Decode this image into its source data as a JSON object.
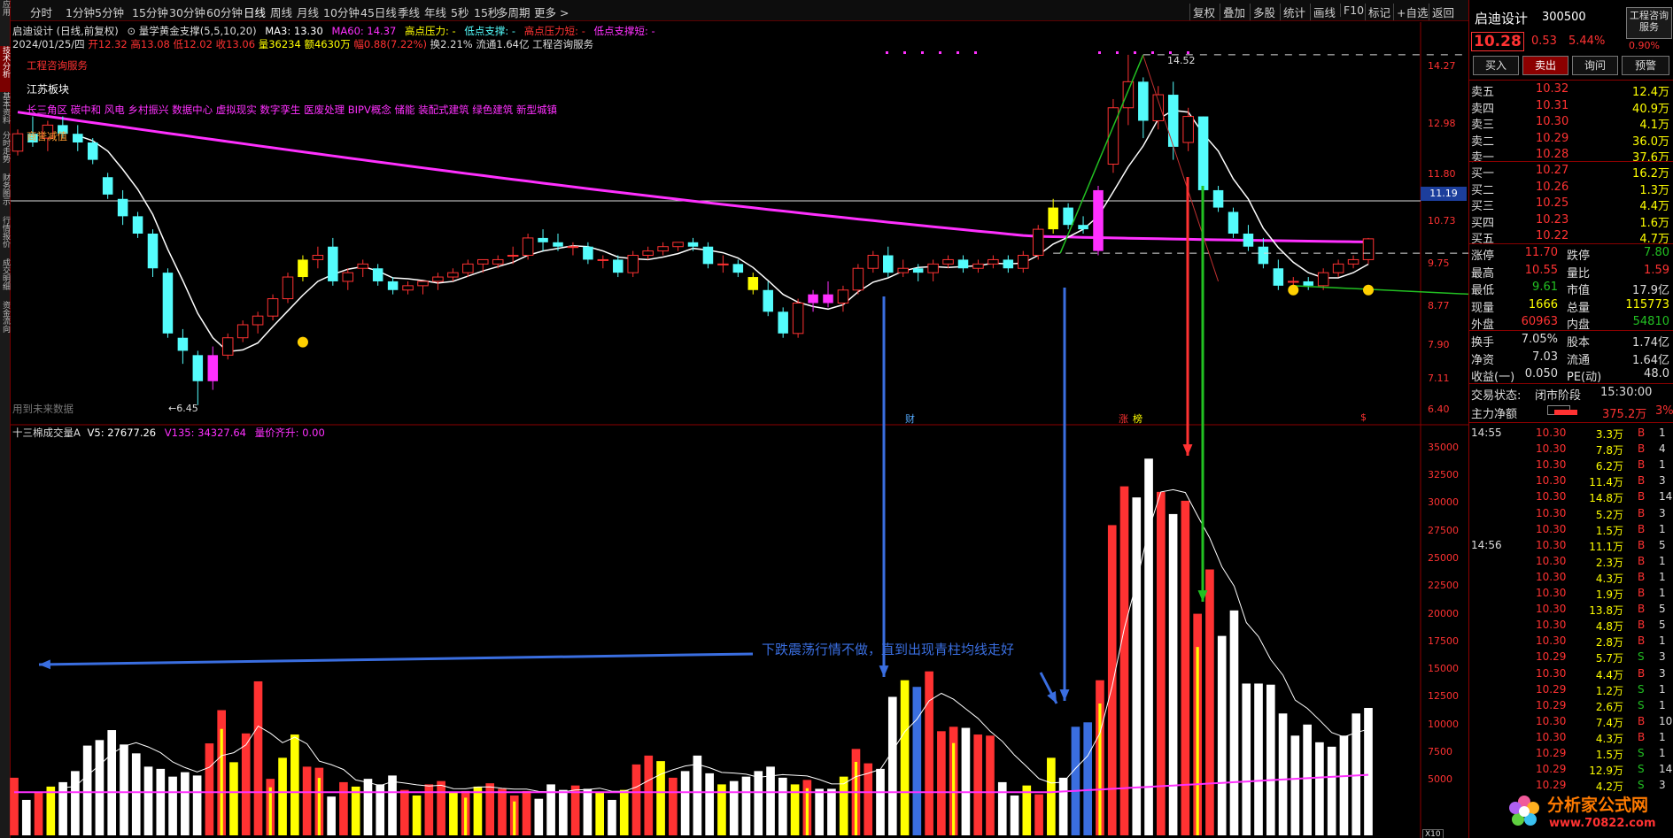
{
  "toolbar": {
    "periods": [
      "分时",
      "1分钟",
      "5分钟",
      "15分钟",
      "30分钟",
      "60分钟",
      "日线",
      "周线",
      "月线",
      "10分钟",
      "45日线",
      "季线",
      "年线",
      "5秒",
      "15秒",
      "多周期",
      "更多 >"
    ],
    "actions": [
      "复权",
      "叠加",
      "多股",
      "统计",
      "画线",
      "F10",
      "标记",
      "+自选",
      "返回"
    ]
  },
  "side_tabs": [
    "应用",
    "技术分析",
    "基本资料",
    "分时走势",
    "财务图示",
    "行情报价",
    "成交明细",
    "资金流向"
  ],
  "chart_header": {
    "line1": [
      "启迪设计 (日线,前复权)",
      "⊙ 量学黄金支撑(5,5,10,20)",
      "MA3: 13.30",
      "MA60: 14.37",
      "高点压力: -",
      "低点支撑: -",
      "高点压力短: -",
      "低点支撑短: -"
    ],
    "line2": [
      "2024/01/25/四",
      "开12.32",
      "高13.08",
      "低12.02",
      "收13.06",
      "量36234",
      "额4630万",
      "幅0.88(7.22%)",
      "换2.21%",
      "流通1.64亿",
      "工程咨询服务"
    ]
  },
  "overlay": {
    "industry": "工程咨询服务",
    "region": "江苏板块",
    "concepts": "长三角区 碳中和 风电 乡村振兴 数据中心 虚拟现实 数字孪生 医废处理 BIPV概念 储能 装配式建筑 绿色建筑 新型城镇",
    "merger": "商誉减值",
    "future_note": "用到未来数据",
    "high_label": "14.52",
    "low_label": "←6.45",
    "marker_cai": "财",
    "marker_zt": "涨",
    "marker_bang": "榜",
    "marker_s": "$"
  },
  "annotation": "下跌震荡行情不做，直到出现青柱均线走好",
  "price_axis": [
    "14.27",
    "12.98",
    "11.80",
    "10.73",
    "9.75",
    "8.77",
    "7.90",
    "7.11",
    "6.40"
  ],
  "current_price_tag": "11.19",
  "volume_header": [
    "十三棉成交量A",
    "V5: 27677.26",
    "V135: 34327.64",
    "量价齐升: 0.00"
  ],
  "volume_axis": [
    "35000",
    "32500",
    "30000",
    "27500",
    "25000",
    "22500",
    "20000",
    "17500",
    "15000",
    "12500",
    "10000",
    "7500",
    "5000"
  ],
  "volume_axis_unit": "X10",
  "stock": {
    "name": "启迪设计",
    "code": "300500",
    "price": "10.28",
    "change": "0.53",
    "pct": "5.44%",
    "badge_line1": "工程咨询",
    "badge_line2": "服务",
    "badge_pct": "0.90%"
  },
  "trade_buttons": [
    "买入",
    "卖出",
    "询问",
    "预警"
  ],
  "order_book": {
    "asks": [
      {
        "label": "卖五",
        "price": "10.32",
        "vol": "12.4万"
      },
      {
        "label": "卖四",
        "price": "10.31",
        "vol": "40.9万"
      },
      {
        "label": "卖三",
        "price": "10.30",
        "vol": "4.1万"
      },
      {
        "label": "卖二",
        "price": "10.29",
        "vol": "36.0万"
      },
      {
        "label": "卖一",
        "price": "10.28",
        "vol": "37.6万"
      }
    ],
    "bids": [
      {
        "label": "买一",
        "price": "10.27",
        "vol": "16.2万"
      },
      {
        "label": "买二",
        "price": "10.26",
        "vol": "1.3万"
      },
      {
        "label": "买三",
        "price": "10.25",
        "vol": "4.4万"
      },
      {
        "label": "买四",
        "price": "10.23",
        "vol": "1.6万"
      },
      {
        "label": "买五",
        "price": "10.22",
        "vol": "4.7万"
      }
    ]
  },
  "quote": [
    {
      "k1": "涨停",
      "v1": "11.70",
      "k2": "跌停",
      "v2": "7.80"
    },
    {
      "k1": "最高",
      "v1": "10.55",
      "k2": "量比",
      "v2": "1.59"
    },
    {
      "k1": "最低",
      "v1": "9.61",
      "k2": "市值",
      "v2": "17.9亿"
    },
    {
      "k1": "现量",
      "v1": "1666",
      "k2": "总量",
      "v2": "115773"
    },
    {
      "k1": "外盘",
      "v1": "60963",
      "k2": "内盘",
      "v2": "54810"
    }
  ],
  "fundamentals": [
    {
      "k1": "换手",
      "v1": "7.05%",
      "k2": "股本",
      "v2": "1.74亿"
    },
    {
      "k1": "净资",
      "v1": "7.03",
      "k2": "流通",
      "v2": "1.64亿"
    },
    {
      "k1": "收益(一)",
      "v1": "0.050",
      "k2": "PE(动)",
      "v2": "48.0"
    }
  ],
  "status": {
    "label": "交易状态:",
    "phase": "闭市阶段",
    "time": "15:30:00"
  },
  "main_net": {
    "label": "主力净额",
    "value": "375.2万",
    "pct": "3%"
  },
  "ticks": [
    {
      "time": "14:55",
      "price": "10.30",
      "vol": "3.3万",
      "side": "B",
      "n": "1"
    },
    {
      "time": "",
      "price": "10.30",
      "vol": "7.8万",
      "side": "B",
      "n": "4"
    },
    {
      "time": "",
      "price": "10.30",
      "vol": "6.2万",
      "side": "B",
      "n": "1"
    },
    {
      "time": "",
      "price": "10.30",
      "vol": "11.4万",
      "side": "B",
      "n": "3"
    },
    {
      "time": "",
      "price": "10.30",
      "vol": "14.8万",
      "side": "B",
      "n": "14"
    },
    {
      "time": "",
      "price": "10.30",
      "vol": "5.2万",
      "side": "B",
      "n": "3"
    },
    {
      "time": "",
      "price": "10.30",
      "vol": "1.5万",
      "side": "B",
      "n": "1"
    },
    {
      "time": "14:56",
      "price": "10.30",
      "vol": "11.1万",
      "side": "B",
      "n": "5"
    },
    {
      "time": "",
      "price": "10.30",
      "vol": "2.3万",
      "side": "B",
      "n": "1"
    },
    {
      "time": "",
      "price": "10.30",
      "vol": "4.3万",
      "side": "B",
      "n": "1"
    },
    {
      "time": "",
      "price": "10.30",
      "vol": "1.9万",
      "side": "B",
      "n": "1"
    },
    {
      "time": "",
      "price": "10.30",
      "vol": "13.8万",
      "side": "B",
      "n": "5"
    },
    {
      "time": "",
      "price": "10.30",
      "vol": "4.8万",
      "side": "B",
      "n": "5"
    },
    {
      "time": "",
      "price": "10.30",
      "vol": "2.8万",
      "side": "B",
      "n": "1"
    },
    {
      "time": "",
      "price": "10.29",
      "vol": "5.7万",
      "side": "S",
      "n": "3"
    },
    {
      "time": "",
      "price": "10.30",
      "vol": "4.4万",
      "side": "B",
      "n": "3"
    },
    {
      "time": "",
      "price": "10.29",
      "vol": "1.2万",
      "side": "S",
      "n": "1"
    },
    {
      "time": "",
      "price": "10.29",
      "vol": "2.6万",
      "side": "S",
      "n": "1"
    },
    {
      "time": "",
      "price": "10.30",
      "vol": "7.4万",
      "side": "B",
      "n": "10"
    },
    {
      "time": "",
      "price": "10.30",
      "vol": "4.3万",
      "side": "B",
      "n": "1"
    },
    {
      "time": "",
      "price": "10.29",
      "vol": "1.5万",
      "side": "S",
      "n": "1"
    },
    {
      "time": "",
      "price": "10.29",
      "vol": "12.9万",
      "side": "S",
      "n": "14"
    },
    {
      "time": "",
      "price": "10.29",
      "vol": "4.2万",
      "side": "S",
      "n": "3"
    }
  ],
  "watermark": {
    "name": "分析家公式网",
    "url": "www.70822.com"
  },
  "colors": {
    "up": "#ff3232",
    "down": "#54fcfc",
    "ma60": "#ff30ff",
    "ma_short": "#ffffff",
    "yellow": "#ffff00",
    "blue": "#3a6ee0",
    "green": "#22c022",
    "border": "#8b0000"
  },
  "chart_data": {
    "type": "candlestick",
    "title": "启迪设计 (日线,前复权)",
    "ylim": [
      6.2,
      14.6
    ],
    "candles": [
      [
        12.3,
        12.8,
        12.2,
        12.7
      ],
      [
        12.7,
        13.1,
        12.4,
        12.5
      ],
      [
        12.6,
        13.0,
        12.3,
        12.9
      ],
      [
        12.9,
        13.1,
        12.6,
        12.7
      ],
      [
        12.7,
        12.9,
        12.3,
        12.5
      ],
      [
        12.5,
        12.6,
        12.0,
        12.1
      ],
      [
        11.7,
        11.8,
        11.2,
        11.3
      ],
      [
        11.2,
        11.4,
        10.6,
        10.8
      ],
      [
        10.8,
        10.9,
        10.3,
        10.4
      ],
      [
        10.4,
        10.5,
        9.4,
        9.6
      ],
      [
        9.5,
        9.6,
        8.0,
        8.1
      ],
      [
        8.0,
        8.2,
        7.4,
        7.7
      ],
      [
        7.6,
        7.7,
        6.45,
        7.0
      ],
      [
        7.0,
        7.8,
        6.8,
        7.6
      ],
      [
        7.6,
        8.1,
        7.5,
        8.0
      ],
      [
        8.0,
        8.4,
        7.9,
        8.3
      ],
      [
        8.3,
        8.6,
        8.1,
        8.5
      ],
      [
        8.5,
        9.0,
        8.4,
        8.9
      ],
      [
        8.9,
        9.5,
        8.8,
        9.4
      ],
      [
        9.4,
        9.9,
        9.3,
        9.8
      ],
      [
        9.8,
        10.1,
        9.6,
        9.9
      ],
      [
        10.1,
        10.3,
        9.2,
        9.3
      ],
      [
        9.3,
        9.6,
        9.1,
        9.5
      ],
      [
        9.6,
        9.8,
        9.4,
        9.7
      ],
      [
        9.6,
        9.7,
        9.2,
        9.3
      ],
      [
        9.3,
        9.4,
        9.0,
        9.1
      ],
      [
        9.1,
        9.3,
        9.0,
        9.2
      ],
      [
        9.2,
        9.3,
        9.0,
        9.3
      ],
      [
        9.3,
        9.5,
        9.1,
        9.4
      ],
      [
        9.4,
        9.6,
        9.3,
        9.5
      ],
      [
        9.5,
        9.8,
        9.4,
        9.7
      ],
      [
        9.7,
        9.8,
        9.5,
        9.8
      ],
      [
        9.7,
        9.9,
        9.6,
        9.8
      ],
      [
        9.9,
        10.1,
        9.7,
        9.9
      ],
      [
        9.9,
        10.4,
        9.8,
        10.3
      ],
      [
        10.3,
        10.5,
        10.0,
        10.2
      ],
      [
        10.2,
        10.4,
        10.0,
        10.1
      ],
      [
        10.1,
        10.2,
        9.9,
        10.1
      ],
      [
        10.1,
        10.2,
        9.7,
        9.8
      ],
      [
        9.8,
        9.9,
        9.6,
        9.8
      ],
      [
        9.8,
        9.9,
        9.4,
        9.5
      ],
      [
        9.5,
        10.0,
        9.4,
        9.9
      ],
      [
        9.9,
        10.1,
        9.8,
        10.0
      ],
      [
        10.0,
        10.2,
        9.9,
        10.1
      ],
      [
        10.1,
        10.2,
        10.0,
        10.2
      ],
      [
        10.2,
        10.3,
        10.0,
        10.1
      ],
      [
        10.1,
        10.2,
        9.6,
        9.7
      ],
      [
        9.7,
        9.9,
        9.5,
        9.7
      ],
      [
        9.7,
        9.8,
        9.4,
        9.5
      ],
      [
        9.4,
        9.5,
        9.0,
        9.1
      ],
      [
        9.1,
        9.3,
        8.5,
        8.6
      ],
      [
        8.6,
        8.7,
        8.0,
        8.1
      ],
      [
        8.1,
        8.9,
        8.0,
        8.8
      ],
      [
        8.8,
        9.1,
        8.6,
        9.0
      ],
      [
        9.0,
        9.3,
        8.7,
        8.8
      ],
      [
        8.8,
        9.2,
        8.6,
        9.1
      ],
      [
        9.1,
        9.7,
        9.0,
        9.6
      ],
      [
        9.6,
        10.0,
        9.5,
        9.9
      ],
      [
        9.9,
        10.1,
        9.4,
        9.5
      ],
      [
        9.5,
        9.8,
        9.4,
        9.6
      ],
      [
        9.6,
        9.7,
        9.3,
        9.5
      ],
      [
        9.5,
        9.8,
        9.3,
        9.7
      ],
      [
        9.7,
        9.9,
        9.6,
        9.8
      ],
      [
        9.8,
        9.9,
        9.5,
        9.6
      ],
      [
        9.6,
        9.8,
        9.5,
        9.7
      ],
      [
        9.7,
        9.9,
        9.6,
        9.8
      ],
      [
        9.8,
        9.9,
        9.5,
        9.6
      ],
      [
        9.6,
        10.0,
        9.5,
        9.9
      ],
      [
        9.9,
        10.6,
        9.8,
        10.5
      ],
      [
        10.5,
        11.2,
        10.4,
        11.0
      ],
      [
        11.0,
        11.1,
        10.5,
        10.6
      ],
      [
        10.6,
        10.8,
        10.4,
        10.5
      ],
      [
        10.0,
        11.5,
        9.9,
        11.4
      ],
      [
        12.0,
        13.5,
        11.8,
        13.3
      ],
      [
        13.3,
        14.52,
        12.9,
        13.9
      ],
      [
        13.9,
        14.0,
        12.6,
        13.0
      ],
      [
        13.0,
        13.8,
        12.8,
        13.6
      ],
      [
        13.6,
        13.9,
        12.1,
        12.4
      ],
      [
        12.5,
        13.3,
        12.3,
        13.1
      ],
      [
        13.1,
        13.1,
        11.1,
        11.4
      ],
      [
        11.4,
        11.5,
        10.9,
        11.0
      ],
      [
        10.9,
        11.0,
        10.3,
        10.4
      ],
      [
        10.4,
        10.6,
        10.0,
        10.1
      ],
      [
        10.1,
        10.3,
        9.6,
        9.7
      ],
      [
        9.6,
        9.8,
        9.1,
        9.2
      ],
      [
        9.3,
        9.4,
        9.1,
        9.3
      ],
      [
        9.3,
        9.4,
        9.1,
        9.2
      ],
      [
        9.2,
        9.6,
        9.1,
        9.5
      ],
      [
        9.5,
        9.8,
        9.4,
        9.7
      ],
      [
        9.7,
        9.9,
        9.6,
        9.8
      ],
      [
        9.8,
        10.3,
        9.7,
        10.28
      ]
    ],
    "highlight_candles": {
      "yellow": [
        19,
        49,
        69
      ],
      "magenta": [
        13,
        53,
        54,
        72
      ]
    },
    "volume": [
      5200,
      3200,
      3900,
      4400,
      4800,
      5800,
      8100,
      8600,
      9500,
      8200,
      7400,
      6200,
      6000,
      5300,
      5700,
      5400,
      8300,
      11300,
      6600,
      9200,
      13900,
      5100,
      7000,
      9100,
      6200,
      6100,
      3500,
      4800,
      4400,
      5100,
      4600,
      5400,
      4100,
      3600,
      4600,
      4900,
      3900,
      4000,
      4400,
      4700,
      4200,
      3600,
      4000,
      3300,
      4600,
      4100,
      4500,
      4200,
      3900,
      3200,
      4100,
      6400,
      7200,
      6700,
      5200,
      5800,
      7200,
      5600,
      4600,
      4900,
      5300,
      5800,
      6200,
      5200,
      4600,
      5000,
      4200,
      4200,
      5300,
      7800,
      6500,
      6000,
      12500,
      14000,
      13400,
      14800,
      9400,
      9800,
      9700,
      9100,
      9000,
      4800,
      3600,
      4500,
      3700,
      7000,
      5200,
      9800,
      10200,
      14000,
      28000,
      31500,
      30500,
      34000,
      31000,
      29000,
      30200,
      20000,
      24000,
      18000,
      20300,
      13700,
      13700,
      13600,
      11000,
      9000,
      10000,
      8400,
      8000,
      9000,
      11000,
      11500
    ],
    "volume_ylim": [
      0,
      36500
    ]
  }
}
